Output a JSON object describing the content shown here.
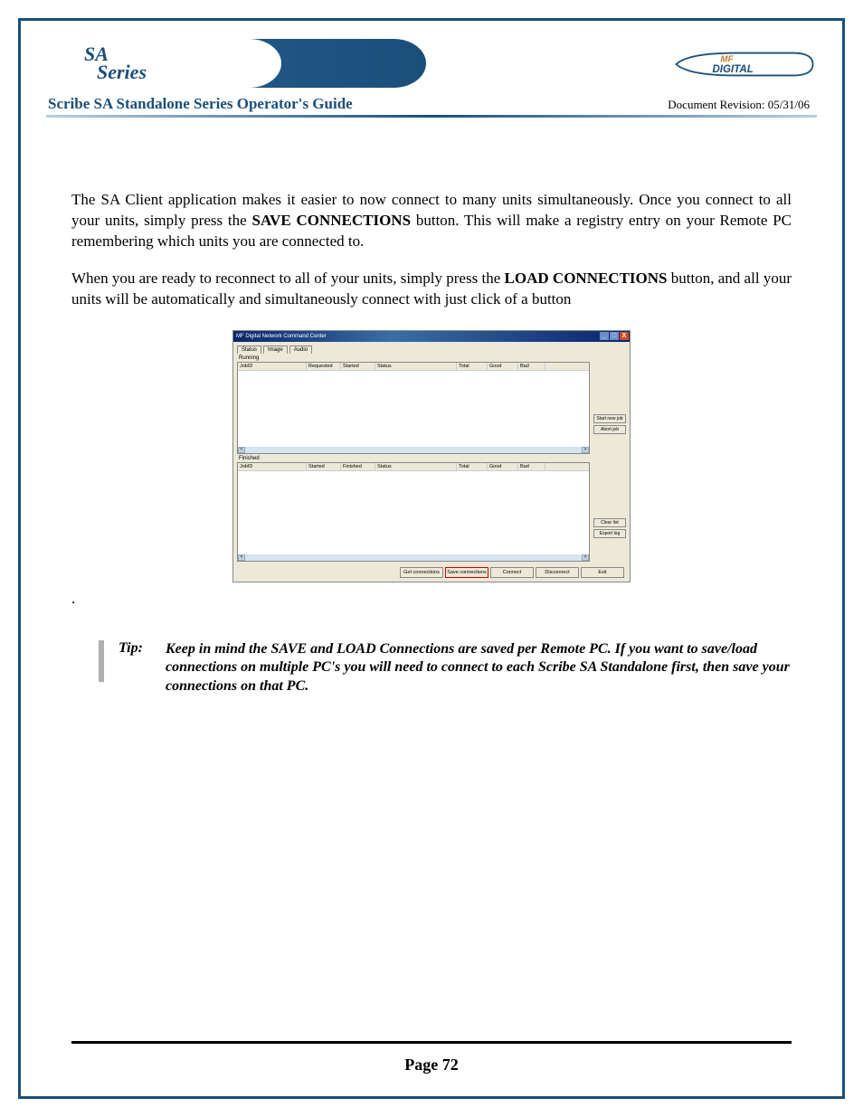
{
  "header": {
    "logo_top": "SA",
    "logo_bottom": "Series",
    "title": "Scribe SA Standalone Series Operator's Guide",
    "revision": "Document Revision: 05/31/06"
  },
  "body": {
    "p1_a": "The SA Client application makes it easier to now connect to many units simultaneously. Once you connect to all your units, simply press the ",
    "p1_b": "SAVE CONNECTIONS",
    "p1_c": " button. This will make a registry entry on your Remote PC remembering which units you are connected to.",
    "p2_a": "When you are ready to reconnect to all of your units, simply press the ",
    "p2_b": "LOAD CONNECTIONS",
    "p2_c": " button, and all your units will be automatically and simultaneously connect with just click of a button",
    "dot": "."
  },
  "screenshot": {
    "title": "MF Digital Network Command Center",
    "tabs": [
      "Status",
      "Image",
      "Audio"
    ],
    "section_running": "Running",
    "section_finished": "Finished",
    "cols_running": {
      "jobid": "JobID",
      "a": "Requested",
      "b": "Started",
      "status": "Status",
      "c": "Total",
      "d": "Good",
      "e": "Bad"
    },
    "cols_finished": {
      "jobid": "JobID",
      "a": "Started",
      "b": "Finished",
      "status": "Status",
      "c": "Total",
      "d": "Good",
      "e": "Bad"
    },
    "side_running": [
      "Start new job",
      "Abort job"
    ],
    "side_finished": [
      "Clear list",
      "Export log"
    ],
    "bottom": {
      "get": "Get connections",
      "save": "Save connections",
      "connect": "Connect",
      "disconnect": "Disconnect",
      "exit": "Exit"
    },
    "scroll_left": "<",
    "scroll_right": ">",
    "win_min": "_",
    "win_max": "□",
    "win_close": "X"
  },
  "tip": {
    "label": "Tip:",
    "text": "Keep in mind the SAVE and LOAD Connections are saved per Remote PC.  If you want to save/load connections on multiple PC's you will need to connect to each Scribe SA Standalone first, then save your connections on that PC."
  },
  "footer": {
    "page": "Page 72"
  }
}
